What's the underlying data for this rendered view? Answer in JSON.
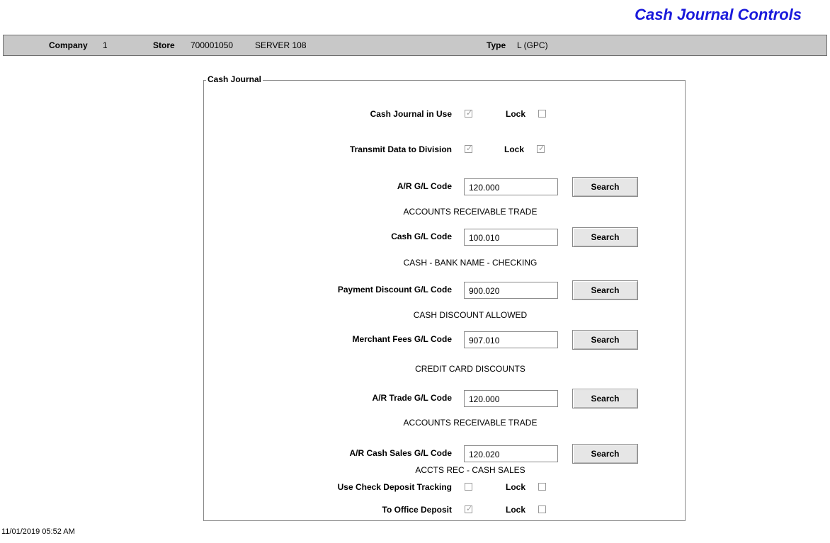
{
  "title": "Cash Journal Controls",
  "info_bar": {
    "company_label": "Company",
    "company_value": "1",
    "store_label": "Store",
    "store_number": "700001050",
    "store_name": "SERVER 108",
    "type_label": "Type",
    "type_value": "L (GPC)"
  },
  "group": {
    "legend": "Cash Journal",
    "lock_label": "Lock",
    "cash_journal_in_use": {
      "label": "Cash Journal in Use",
      "checked": true,
      "lock_checked": false
    },
    "transmit_data": {
      "label": "Transmit Data to Division",
      "checked": true,
      "lock_checked": true
    },
    "gl_rows": [
      {
        "label": "A/R G/L Code",
        "value": "120.000",
        "button": "Search",
        "description": "ACCOUNTS RECEIVABLE TRADE"
      },
      {
        "label": "Cash G/L Code",
        "value": "100.010",
        "button": "Search",
        "description": "CASH - BANK NAME - CHECKING"
      },
      {
        "label": "Payment Discount G/L Code",
        "value": "900.020",
        "button": "Search",
        "description": "CASH DISCOUNT ALLOWED"
      },
      {
        "label": "Merchant Fees G/L Code",
        "value": "907.010",
        "button": "Search",
        "description": "CREDIT CARD DISCOUNTS"
      },
      {
        "label": "A/R Trade G/L Code",
        "value": "120.000",
        "button": "Search",
        "description": "ACCOUNTS RECEIVABLE TRADE"
      },
      {
        "label": "A/R Cash Sales G/L Code",
        "value": "120.020",
        "button": "Search",
        "description": "ACCTS REC - CASH SALES"
      }
    ],
    "use_check_deposit": {
      "label": "Use Check Deposit Tracking",
      "checked": false,
      "lock_checked": false
    },
    "to_office_deposit": {
      "label": "To Office Deposit",
      "checked": true,
      "lock_checked": false
    }
  },
  "footer": {
    "timestamp": "11/01/2019 05:52 AM"
  },
  "colors": {
    "title": "#1a1adb",
    "bar": "#c8c8c8"
  }
}
